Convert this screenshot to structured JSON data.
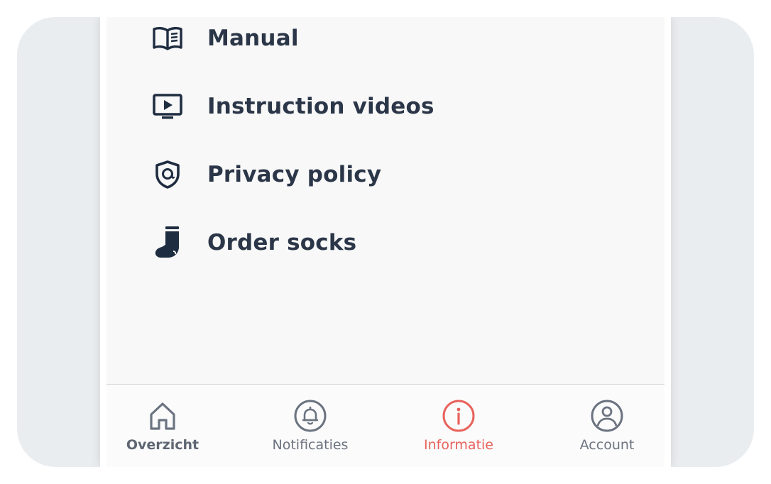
{
  "menu": {
    "items": [
      {
        "label": "Manual",
        "icon": "book-icon"
      },
      {
        "label": "Instruction videos",
        "icon": "video-play-icon"
      },
      {
        "label": "Privacy policy",
        "icon": "shield-at-icon"
      },
      {
        "label": "Order socks",
        "icon": "sock-icon"
      }
    ]
  },
  "tabbar": {
    "tabs": [
      {
        "label": "Overzicht",
        "icon": "home-icon",
        "state": "current-bold"
      },
      {
        "label": "Notificaties",
        "icon": "bell-icon",
        "state": "inactive"
      },
      {
        "label": "Informatie",
        "icon": "info-icon",
        "state": "active"
      },
      {
        "label": "Account",
        "icon": "user-circle-icon",
        "state": "inactive"
      }
    ]
  },
  "colors": {
    "text_dark": "#2b3648",
    "icon_dark": "#1f2d41",
    "tab_inactive": "#6b7380",
    "tab_active": "#e8625c",
    "background_outer": "#eaedf0",
    "content_background": "#f8f8f8"
  }
}
